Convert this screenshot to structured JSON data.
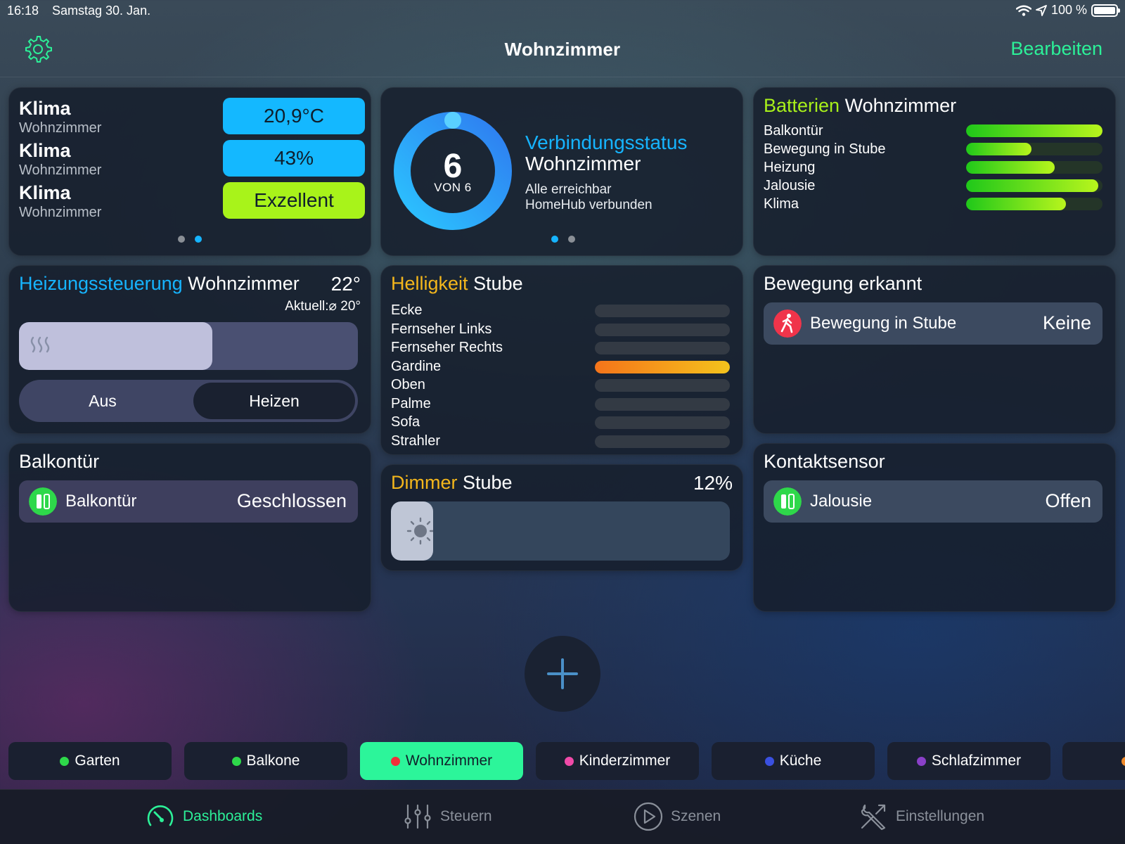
{
  "status_bar": {
    "time": "16:18",
    "date": "Samstag 30. Jan.",
    "battery": "100 %"
  },
  "nav": {
    "title": "Wohnzimmer",
    "edit_label": "Bearbeiten"
  },
  "klima_card": {
    "rows": [
      {
        "name": "Klima",
        "sub": "Wohnzimmer",
        "value": "20,9°C"
      },
      {
        "name": "Klima",
        "sub": "Wohnzimmer",
        "value": "43%"
      },
      {
        "name": "Klima",
        "sub": "Wohnzimmer",
        "value": "Exzellent"
      }
    ]
  },
  "connection_card": {
    "count": "6",
    "of_label": "VON 6",
    "title": "Verbindungsstatus",
    "subtitle": "Wohnzimmer",
    "lines": [
      "Alle erreichbar",
      "HomeHub verbunden"
    ],
    "ring_progress": 1.0
  },
  "battery_card": {
    "title_accent": "Batterien",
    "title_rest": "Wohnzimmer",
    "items": [
      {
        "label": "Balkontür",
        "level": 1.0
      },
      {
        "label": "Bewegung in Stube",
        "level": 0.48
      },
      {
        "label": "Heizung",
        "level": 0.65
      },
      {
        "label": "Jalousie",
        "level": 0.97
      },
      {
        "label": "Klima",
        "level": 0.73
      }
    ]
  },
  "heating_card": {
    "title_accent": "Heizungssteuerung",
    "title_rest": "Wohnzimmer",
    "target": "22°",
    "current": "Aktuell:⌀ 20°",
    "slider_level": 0.57,
    "modes": [
      "Aus",
      "Heizen"
    ],
    "active_mode": 1
  },
  "brightness_card": {
    "title_accent": "Helligkeit",
    "title_rest": "Stube",
    "items": [
      {
        "label": "Ecke",
        "level": 0
      },
      {
        "label": "Fernseher Links",
        "level": 0
      },
      {
        "label": "Fernseher Rechts",
        "level": 0
      },
      {
        "label": "Gardine",
        "level": 1.0
      },
      {
        "label": "Oben",
        "level": 0
      },
      {
        "label": "Palme",
        "level": 0
      },
      {
        "label": "Sofa",
        "level": 0
      },
      {
        "label": "Strahler",
        "level": 0
      }
    ]
  },
  "motion_card": {
    "title": "Bewegung erkannt",
    "item": "Bewegung in Stube",
    "value": "Keine"
  },
  "door_card": {
    "title": "Balkontür",
    "item": "Balkontür",
    "value": "Geschlossen"
  },
  "dimmer_card": {
    "title_accent": "Dimmer",
    "title_rest": "Stube",
    "value": "12%"
  },
  "contact_card": {
    "title": "Kontaktsensor",
    "item": "Jalousie",
    "value": "Offen"
  },
  "rooms": [
    {
      "label": "Garten",
      "color": "#2ed84a"
    },
    {
      "label": "Balkone",
      "color": "#2ed84a"
    },
    {
      "label": "Wohnzimmer",
      "color": "#f0303a",
      "active": true
    },
    {
      "label": "Kinderzimmer",
      "color": "#f04aa8"
    },
    {
      "label": "Küche",
      "color": "#3a50e0"
    },
    {
      "label": "Schlafzimmer",
      "color": "#8a40c8"
    }
  ],
  "tabbar": {
    "items": [
      {
        "label": "Dashboards",
        "icon": "gauge-icon"
      },
      {
        "label": "Steuern",
        "icon": "sliders-icon"
      },
      {
        "label": "Szenen",
        "icon": "play-icon"
      },
      {
        "label": "Einstellungen",
        "icon": "tools-icon"
      }
    ]
  },
  "colors": {
    "accent_green": "#2cf098",
    "accent_blue": "#16b4ff",
    "battery_green": "#a8f01a",
    "brightness_orange": "#f3b61c"
  }
}
